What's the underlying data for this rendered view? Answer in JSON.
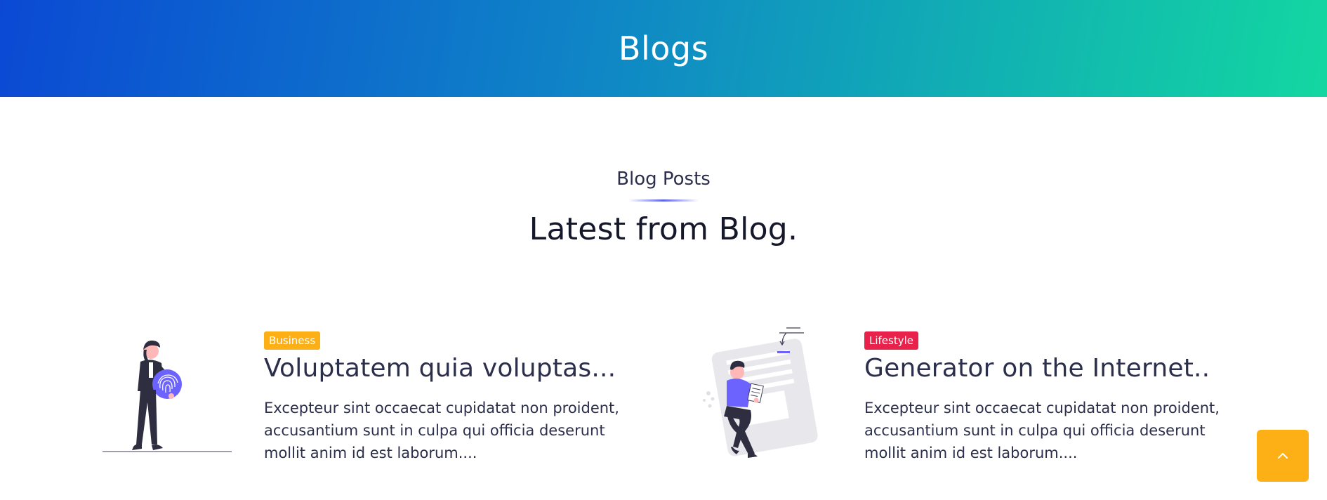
{
  "hero": {
    "title": "Blogs"
  },
  "section": {
    "subtitle": "Blog Posts",
    "title": "Latest from Blog."
  },
  "posts": [
    {
      "category": "Business",
      "category_color": "#fdb015",
      "title": "Voluptatem quia voluptas...",
      "excerpt": "Excepteur sint occaecat cupidatat non proident, accusantium sunt in culpa qui officia deserunt mollit anim id est laborum....",
      "illustration": "person-fingerprint-illustration"
    },
    {
      "category": "Lifestyle",
      "category_color": "#e8224a",
      "title": "Generator on the Internet..",
      "excerpt": "Excepteur sint occaecat cupidatat non proident, accusantium sunt in culpa qui officia deserunt mollit anim id est laborum....",
      "illustration": "person-reading-document-illustration"
    }
  ],
  "scroll_top": {
    "icon": "chevron-up-icon",
    "color": "#fdb015"
  },
  "colors": {
    "hero_start": "#0b49d4",
    "hero_end": "#13d7a1",
    "accent": "#5b63e8",
    "text": "#2b2f4c"
  }
}
